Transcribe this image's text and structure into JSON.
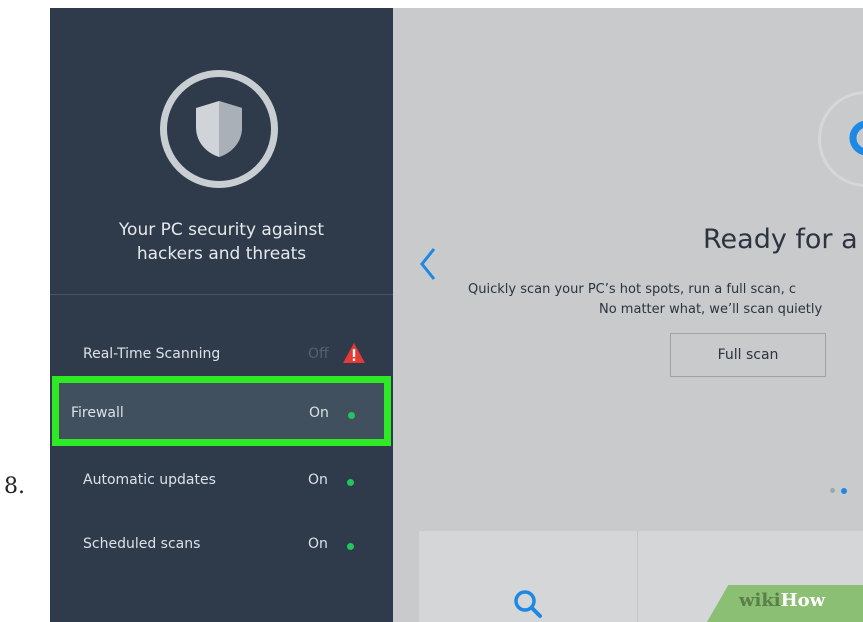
{
  "step_number": "8.",
  "sidebar": {
    "title_line1": "Your PC security against",
    "title_line2": "hackers and threats",
    "items": [
      {
        "label": "Real-Time Scanning",
        "status": "Off"
      },
      {
        "label": "Firewall",
        "status": "On"
      },
      {
        "label": "Automatic updates",
        "status": "On"
      },
      {
        "label": "Scheduled scans",
        "status": "On"
      }
    ]
  },
  "main": {
    "title": "Ready for a",
    "desc_line1": "Quickly scan your PC’s hot spots, run a full scan, c",
    "desc_line2": "No matter what, we’ll scan quietly",
    "full_scan_label": "Full scan"
  },
  "watermark": {
    "wiki": "wiki",
    "how": "How"
  },
  "colors": {
    "sidebar_bg": "#2f3b4b",
    "highlight_border": "#2dea25",
    "status_on_dot": "#22c55e",
    "warning": "#e53935",
    "accent_blue": "#1e88e5",
    "main_bg": "#c8cacc"
  },
  "icons": {
    "shield": "shield-icon",
    "warning": "warning-icon",
    "back": "chevron-left-icon",
    "scan": "scan-icon",
    "search": "search-icon"
  }
}
